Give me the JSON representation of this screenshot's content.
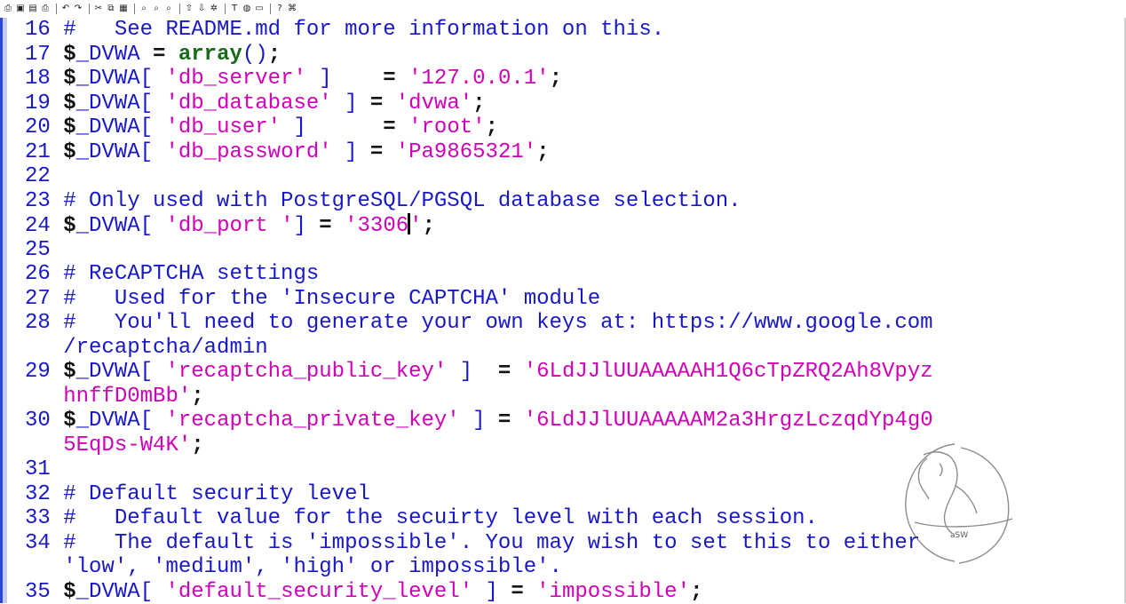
{
  "toolbar": {
    "buttons": [
      {
        "name": "print-preview-icon",
        "glyph": "⎙"
      },
      {
        "name": "save-icon",
        "glyph": "▣"
      },
      {
        "name": "save-all-icon",
        "glyph": "▤"
      },
      {
        "name": "print-icon",
        "glyph": "⎙"
      },
      {
        "name": "sep"
      },
      {
        "name": "undo-icon",
        "glyph": "↶"
      },
      {
        "name": "redo-icon",
        "glyph": "↷"
      },
      {
        "name": "sep"
      },
      {
        "name": "cut-icon",
        "glyph": "✂"
      },
      {
        "name": "copy-icon",
        "glyph": "⧉"
      },
      {
        "name": "paste-icon",
        "glyph": "▦"
      },
      {
        "name": "sep"
      },
      {
        "name": "find-icon",
        "glyph": "⌕"
      },
      {
        "name": "find-next-icon",
        "glyph": "⌕"
      },
      {
        "name": "replace-icon",
        "glyph": "⌕"
      },
      {
        "name": "sep"
      },
      {
        "name": "ftp-upload-icon",
        "glyph": "⇧"
      },
      {
        "name": "ftp-download-icon",
        "glyph": "⇩"
      },
      {
        "name": "tools-icon",
        "glyph": "✲"
      },
      {
        "name": "sep"
      },
      {
        "name": "font-icon",
        "glyph": "T"
      },
      {
        "name": "color-icon",
        "glyph": "◍"
      },
      {
        "name": "highlight-icon",
        "glyph": "▭"
      },
      {
        "name": "sep"
      },
      {
        "name": "help-icon",
        "glyph": "?"
      },
      {
        "name": "context-help-icon",
        "glyph": "⌘"
      }
    ]
  },
  "editor": {
    "cursor_line": 24,
    "lines": [
      {
        "ln": "16",
        "tokens": [
          [
            "cm",
            "#   See README.md for more information on this."
          ]
        ]
      },
      {
        "ln": "17",
        "tokens": [
          [
            "dollar",
            "$"
          ],
          [
            "var",
            "_DVWA"
          ],
          [
            "op",
            " = "
          ],
          [
            "fn",
            "array"
          ],
          [
            "brk",
            "()"
          ],
          [
            "punc",
            ";"
          ]
        ]
      },
      {
        "ln": "18",
        "tokens": [
          [
            "dollar",
            "$"
          ],
          [
            "var",
            "_DVWA"
          ],
          [
            "brk",
            "[ "
          ],
          [
            "str",
            "'db_server'"
          ],
          [
            "brk",
            " ]   "
          ],
          [
            "op",
            " = "
          ],
          [
            "str",
            "'127.0.0.1'"
          ],
          [
            "punc",
            ";"
          ]
        ]
      },
      {
        "ln": "19",
        "tokens": [
          [
            "dollar",
            "$"
          ],
          [
            "var",
            "_DVWA"
          ],
          [
            "brk",
            "[ "
          ],
          [
            "str",
            "'db_database'"
          ],
          [
            "brk",
            " ]"
          ],
          [
            "op",
            " = "
          ],
          [
            "str",
            "'dvwa'"
          ],
          [
            "punc",
            ";"
          ]
        ]
      },
      {
        "ln": "20",
        "tokens": [
          [
            "dollar",
            "$"
          ],
          [
            "var",
            "_DVWA"
          ],
          [
            "brk",
            "[ "
          ],
          [
            "str",
            "'db_user'"
          ],
          [
            "brk",
            " ]     "
          ],
          [
            "op",
            " = "
          ],
          [
            "str",
            "'root'"
          ],
          [
            "punc",
            ";"
          ]
        ]
      },
      {
        "ln": "21",
        "tokens": [
          [
            "dollar",
            "$"
          ],
          [
            "var",
            "_DVWA"
          ],
          [
            "brk",
            "[ "
          ],
          [
            "str",
            "'db_password'"
          ],
          [
            "brk",
            " ]"
          ],
          [
            "op",
            " = "
          ],
          [
            "str",
            "'Pa9865321'"
          ],
          [
            "punc",
            ";"
          ]
        ]
      },
      {
        "ln": "22",
        "tokens": []
      },
      {
        "ln": "23",
        "tokens": [
          [
            "cm",
            "# Only used with PostgreSQL/PGSQL database selection."
          ]
        ]
      },
      {
        "ln": "24",
        "tokens": [
          [
            "dollar",
            "$"
          ],
          [
            "var",
            "_DVWA"
          ],
          [
            "brk",
            "[ "
          ],
          [
            "str",
            "'db_port '"
          ],
          [
            "brk",
            "]"
          ],
          [
            "op",
            " = "
          ],
          [
            "str",
            "'3306"
          ],
          [
            "cursor",
            ""
          ],
          [
            "str",
            "'"
          ],
          [
            "punc",
            ";"
          ]
        ]
      },
      {
        "ln": "25",
        "tokens": []
      },
      {
        "ln": "26",
        "tokens": [
          [
            "cm",
            "# ReCAPTCHA settings"
          ]
        ]
      },
      {
        "ln": "27",
        "tokens": [
          [
            "cm",
            "#   Used for the 'Insecure CAPTCHA' module"
          ]
        ]
      },
      {
        "ln": "28",
        "tokens": [
          [
            "cm",
            "#   You'll need to generate your own keys at: https://www.google.com"
          ]
        ]
      },
      {
        "ln": "",
        "tokens": [
          [
            "cm",
            "/recaptcha/admin"
          ]
        ]
      },
      {
        "ln": "29",
        "tokens": [
          [
            "dollar",
            "$"
          ],
          [
            "var",
            "_DVWA"
          ],
          [
            "brk",
            "[ "
          ],
          [
            "str",
            "'recaptcha_public_key'"
          ],
          [
            "brk",
            " ] "
          ],
          [
            "op",
            " = "
          ],
          [
            "str",
            "'6LdJJlUUAAAAAH1Q6cTpZRQ2Ah8Vpyz"
          ]
        ]
      },
      {
        "ln": "",
        "tokens": [
          [
            "str",
            "hnffD0mBb'"
          ],
          [
            "punc",
            ";"
          ]
        ]
      },
      {
        "ln": "30",
        "tokens": [
          [
            "dollar",
            "$"
          ],
          [
            "var",
            "_DVWA"
          ],
          [
            "brk",
            "[ "
          ],
          [
            "str",
            "'recaptcha_private_key'"
          ],
          [
            "brk",
            " ]"
          ],
          [
            "op",
            " = "
          ],
          [
            "str",
            "'6LdJJlUUAAAAAM2a3HrgzLczqdYp4g0"
          ]
        ]
      },
      {
        "ln": "",
        "tokens": [
          [
            "str",
            "5EqDs-W4K'"
          ],
          [
            "punc",
            ";"
          ]
        ]
      },
      {
        "ln": "31",
        "tokens": []
      },
      {
        "ln": "32",
        "tokens": [
          [
            "cm",
            "# Default security level"
          ]
        ]
      },
      {
        "ln": "33",
        "tokens": [
          [
            "cm",
            "#   Default value for the secuirty level with each session."
          ]
        ]
      },
      {
        "ln": "34",
        "tokens": [
          [
            "cm",
            "#   The default is 'impossible'. You may wish to set this to either"
          ]
        ]
      },
      {
        "ln": "",
        "tokens": [
          [
            "cm",
            "'low', 'medium', 'high' or impossible'."
          ]
        ]
      },
      {
        "ln": "35",
        "tokens": [
          [
            "dollar",
            "$"
          ],
          [
            "var",
            "_DVWA"
          ],
          [
            "brk",
            "[ "
          ],
          [
            "str",
            "'default_security_level'"
          ],
          [
            "brk",
            " ]"
          ],
          [
            "op",
            " = "
          ],
          [
            "str",
            "'impossible'"
          ],
          [
            "punc",
            ";"
          ]
        ]
      }
    ]
  },
  "watermark": {
    "label": "aSW"
  }
}
